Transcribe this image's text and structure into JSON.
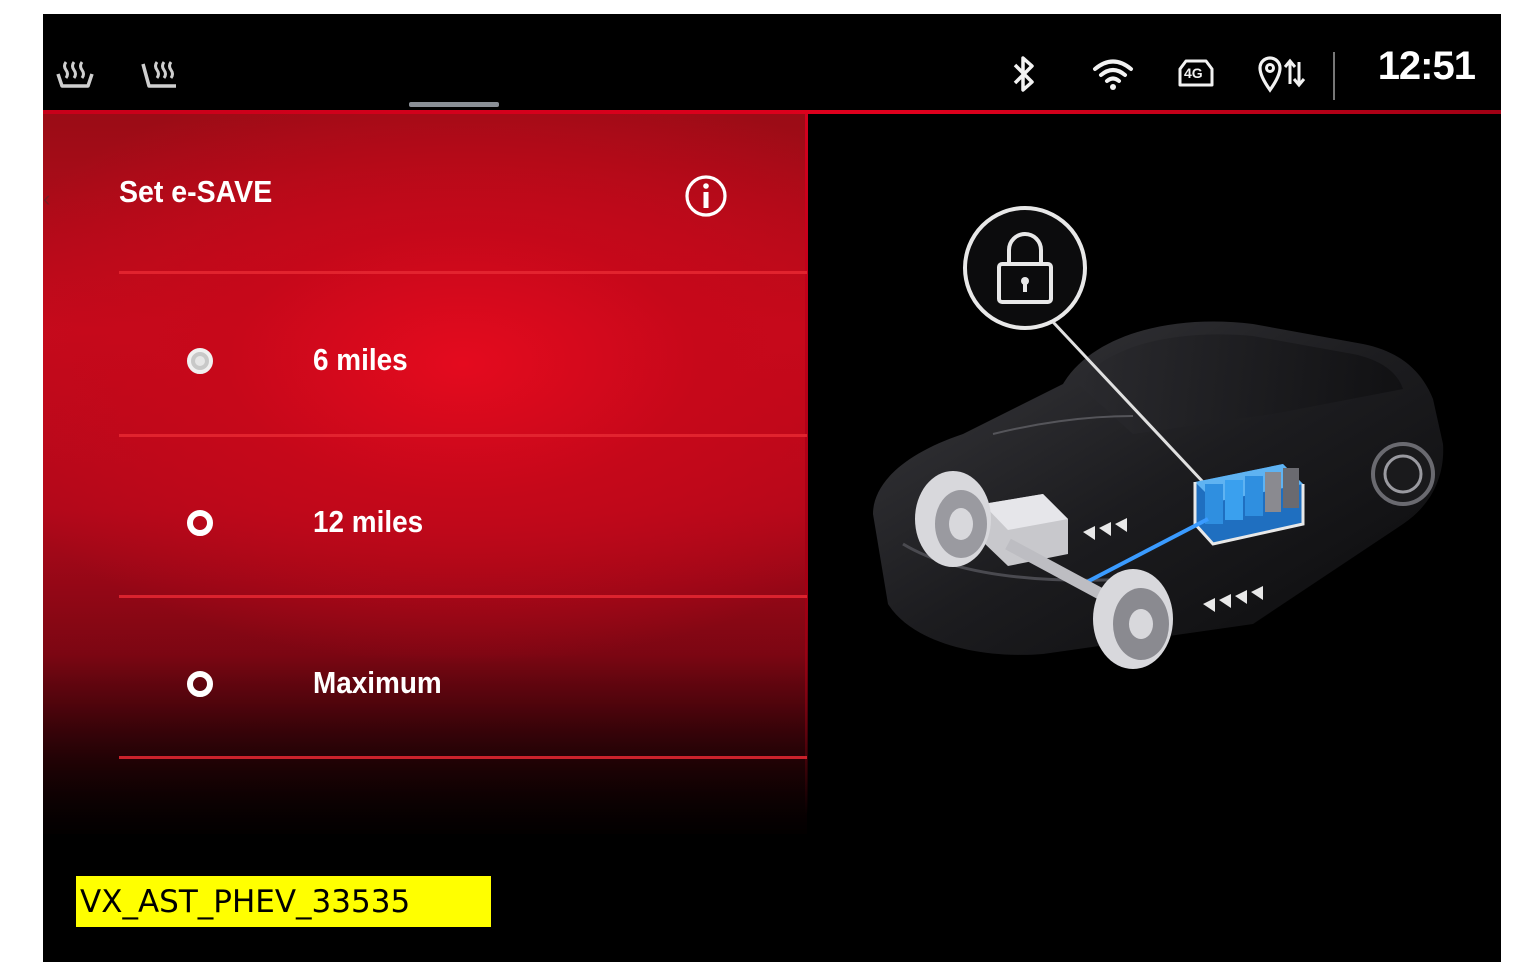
{
  "status_bar": {
    "icons": [
      "seat-heat-driver-icon",
      "seat-heat-passenger-icon",
      "bluetooth-icon",
      "wifi-icon",
      "4g-icon",
      "location-data-icon"
    ],
    "lte_label": "4G",
    "time": "12:51"
  },
  "panel": {
    "title": "Set e-SAVE",
    "info_icon": "info-icon",
    "options": [
      {
        "label": "6 miles",
        "selected": true
      },
      {
        "label": "12 miles",
        "selected": false
      },
      {
        "label": "Maximum",
        "selected": false
      }
    ]
  },
  "illustration": {
    "icon": "lock-icon",
    "battery_color": "#2f8fe0"
  },
  "caption": "VX_AST_PHEV_33535",
  "colors": {
    "accent_red": "#d4001e",
    "caption_bg": "#ffff00"
  }
}
